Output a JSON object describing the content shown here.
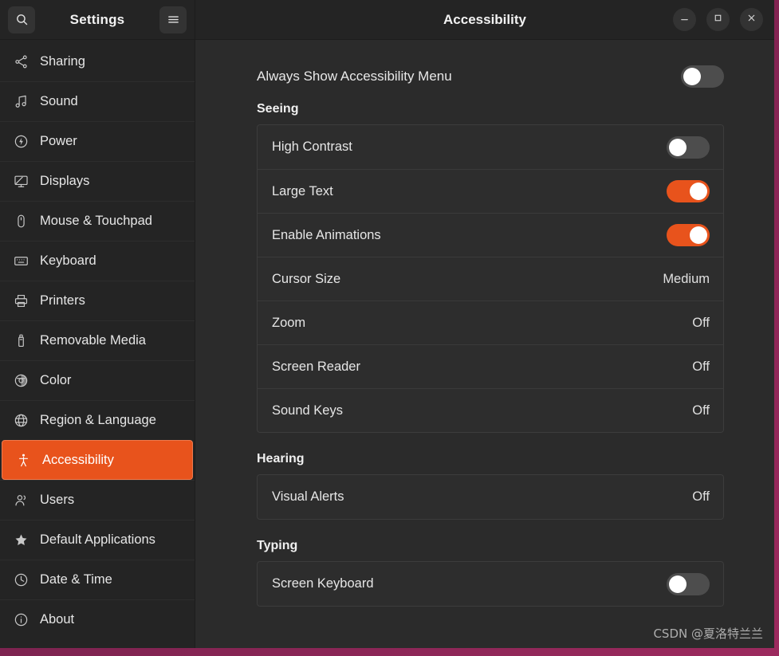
{
  "window": {
    "app_title": "Settings",
    "page_title": "Accessibility",
    "search_icon": "search-icon",
    "menu_icon": "hamburger-menu-icon",
    "minimize_icon": "minimize-icon",
    "maximize_icon": "maximize-icon",
    "close_icon": "close-icon"
  },
  "colors": {
    "accent": "#e8531c",
    "accent_border": "#ef7a4d",
    "sidebar_bg": "#242424",
    "main_bg": "#2b2b2b",
    "card_bg": "#2d2d2d",
    "toggle_off": "#4d4d4d",
    "desktop": "#7d2350"
  },
  "sidebar": {
    "items": [
      {
        "label": "Sharing",
        "icon": "share-nodes-icon",
        "selected": false
      },
      {
        "label": "Sound",
        "icon": "music-note-icon",
        "selected": false
      },
      {
        "label": "Power",
        "icon": "power-bolt-icon",
        "selected": false
      },
      {
        "label": "Displays",
        "icon": "monitor-icon",
        "selected": false
      },
      {
        "label": "Mouse & Touchpad",
        "icon": "mouse-icon",
        "selected": false
      },
      {
        "label": "Keyboard",
        "icon": "keyboard-icon",
        "selected": false
      },
      {
        "label": "Printers",
        "icon": "printer-icon",
        "selected": false
      },
      {
        "label": "Removable Media",
        "icon": "usb-drive-icon",
        "selected": false
      },
      {
        "label": "Color",
        "icon": "color-wheel-icon",
        "selected": false
      },
      {
        "label": "Region & Language",
        "icon": "globe-icon",
        "selected": false
      },
      {
        "label": "Accessibility",
        "icon": "accessibility-icon",
        "selected": true
      },
      {
        "label": "Users",
        "icon": "users-icon",
        "selected": false
      },
      {
        "label": "Default Applications",
        "icon": "star-icon",
        "selected": false
      },
      {
        "label": "Date & Time",
        "icon": "clock-icon",
        "selected": false
      },
      {
        "label": "About",
        "icon": "info-circle-icon",
        "selected": false
      }
    ]
  },
  "main": {
    "always_show": {
      "label": "Always Show Accessibility Menu",
      "type": "toggle",
      "on": false
    },
    "sections": [
      {
        "title": "Seeing",
        "rows": [
          {
            "label": "High Contrast",
            "type": "toggle",
            "on": false
          },
          {
            "label": "Large Text",
            "type": "toggle",
            "on": true
          },
          {
            "label": "Enable Animations",
            "type": "toggle",
            "on": true
          },
          {
            "label": "Cursor Size",
            "type": "value",
            "value": "Medium"
          },
          {
            "label": "Zoom",
            "type": "value",
            "value": "Off"
          },
          {
            "label": "Screen Reader",
            "type": "value",
            "value": "Off"
          },
          {
            "label": "Sound Keys",
            "type": "value",
            "value": "Off"
          }
        ]
      },
      {
        "title": "Hearing",
        "rows": [
          {
            "label": "Visual Alerts",
            "type": "value",
            "value": "Off"
          }
        ]
      },
      {
        "title": "Typing",
        "rows": [
          {
            "label": "Screen Keyboard",
            "type": "toggle",
            "on": false
          }
        ]
      }
    ]
  },
  "watermark": {
    "text": "CSDN @夏洛特兰兰"
  }
}
